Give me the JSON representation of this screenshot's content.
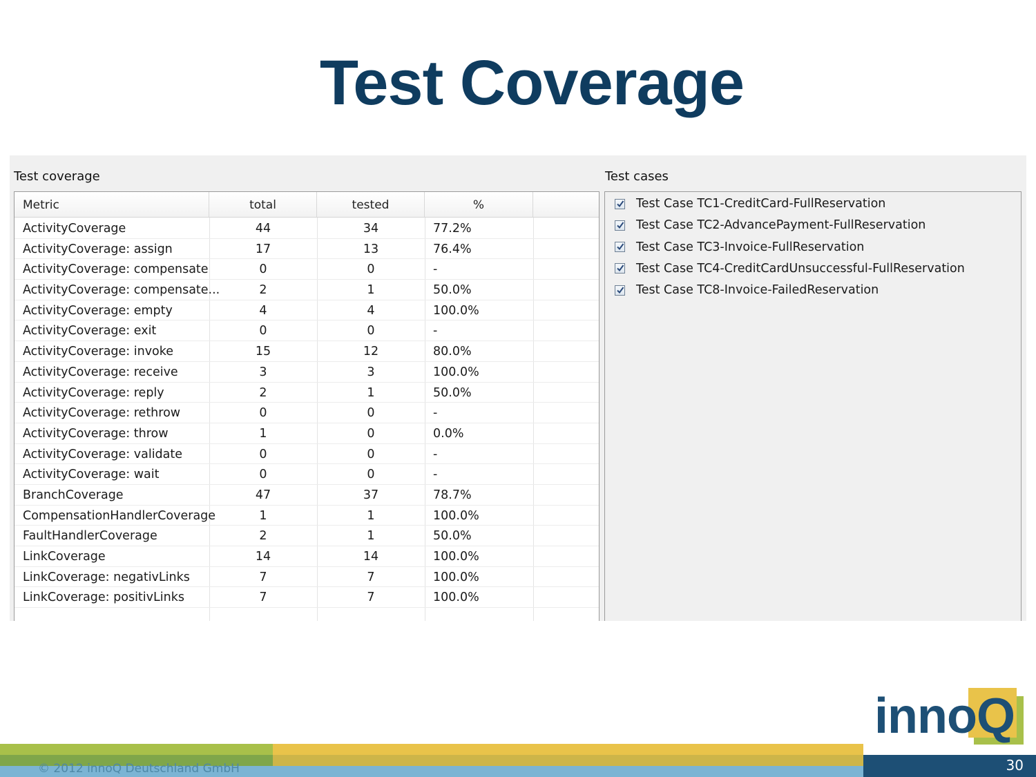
{
  "slide": {
    "title": "Test Coverage",
    "copyright": "© 2012 innoQ Deutschland GmbH",
    "page_number": "30",
    "logo": "innoQ"
  },
  "coverage": {
    "title": "Test coverage",
    "columns": [
      "Metric",
      "total",
      "tested",
      "%"
    ],
    "rows": [
      [
        "ActivityCoverage",
        "44",
        "34",
        "77.2%"
      ],
      [
        "ActivityCoverage: assign",
        "17",
        "13",
        "76.4%"
      ],
      [
        "ActivityCoverage: compensate",
        "0",
        "0",
        "-"
      ],
      [
        "ActivityCoverage: compensate...",
        "2",
        "1",
        "50.0%"
      ],
      [
        "ActivityCoverage: empty",
        "4",
        "4",
        "100.0%"
      ],
      [
        "ActivityCoverage: exit",
        "0",
        "0",
        "-"
      ],
      [
        "ActivityCoverage: invoke",
        "15",
        "12",
        "80.0%"
      ],
      [
        "ActivityCoverage: receive",
        "3",
        "3",
        "100.0%"
      ],
      [
        "ActivityCoverage: reply",
        "2",
        "1",
        "50.0%"
      ],
      [
        "ActivityCoverage: rethrow",
        "0",
        "0",
        "-"
      ],
      [
        "ActivityCoverage: throw",
        "1",
        "0",
        "0.0%"
      ],
      [
        "ActivityCoverage: validate",
        "0",
        "0",
        "-"
      ],
      [
        "ActivityCoverage: wait",
        "0",
        "0",
        "-"
      ],
      [
        "BranchCoverage",
        "47",
        "37",
        "78.7%"
      ],
      [
        "CompensationHandlerCoverage",
        "1",
        "1",
        "100.0%"
      ],
      [
        "FaultHandlerCoverage",
        "2",
        "1",
        "50.0%"
      ],
      [
        "LinkCoverage",
        "14",
        "14",
        "100.0%"
      ],
      [
        "LinkCoverage: negativLinks",
        "7",
        "7",
        "100.0%"
      ],
      [
        "LinkCoverage: positivLinks",
        "7",
        "7",
        "100.0%"
      ]
    ]
  },
  "cases": {
    "title": "Test cases",
    "items": [
      {
        "label": "Test Case TC1-CreditCard-FullReservation",
        "checked": true
      },
      {
        "label": "Test Case TC2-AdvancePayment-FullReservation",
        "checked": true
      },
      {
        "label": "Test Case TC3-Invoice-FullReservation",
        "checked": true
      },
      {
        "label": "Test Case TC4-CreditCardUnsuccessful-FullReservation",
        "checked": true
      },
      {
        "label": "Test Case TC8-Invoice-FailedReservation",
        "checked": true
      }
    ]
  },
  "colors": {
    "title": "#0f3c5f",
    "brand_blue": "#1d4f75",
    "brand_yellow": "#e9c34a",
    "brand_green": "#a8c04a"
  }
}
